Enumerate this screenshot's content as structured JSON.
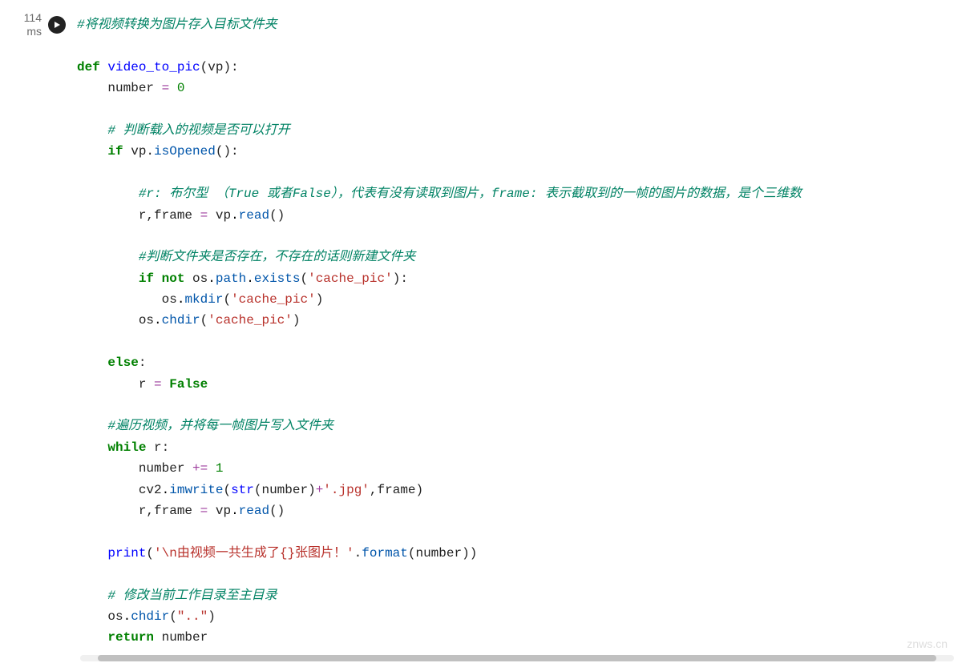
{
  "exec_time_value": "114",
  "exec_time_unit": "ms",
  "toolbar": {
    "add_label": "+",
    "close_label": "✕",
    "check_label": "✓",
    "delete_label": "🗑"
  },
  "watermark": "znws.cn",
  "code": {
    "comment_top": "#将视频转换为图片存入目标文件夹",
    "kw_def": "def",
    "fn_name": "video_to_pic",
    "fn_params": "(vp):",
    "line_number_init_name": "number",
    "line_number_init_op": "=",
    "line_number_init_val": "0",
    "comment_check_open": "# 判断载入的视频是否可以打开",
    "kw_if1": "if",
    "if1_obj": "vp",
    "dot1": ".",
    "if1_method": "isOpened",
    "if1_tail": "():",
    "comment_rframe": "#r: 布尔型 （True 或者False），代表有没有读取到图片，frame: 表示截取到的一帧的图片的数据，是个三维数",
    "rframe_left": "r,frame",
    "rframe_op": "=",
    "rframe_obj": "vp",
    "rframe_method": "read",
    "rframe_tail": "()",
    "comment_mkdir": "#判断文件夹是否存在，不存在的话则新建文件夹",
    "kw_if2": "if",
    "kw_not": "not",
    "exists_obj1": "os",
    "exists_attr1": "path",
    "exists_method": "exists",
    "exists_open": "(",
    "exists_str": "'cache_pic'",
    "exists_close": "):",
    "mkdir_obj": "os",
    "mkdir_method": "mkdir",
    "mkdir_open": "(",
    "mkdir_str": "'cache_pic'",
    "mkdir_close": ")",
    "chdir_obj": "os",
    "chdir_method": "chdir",
    "chdir_open": "(",
    "chdir_str": "'cache_pic'",
    "chdir_close": ")",
    "kw_else": "else",
    "else_colon": ":",
    "else_r": "r",
    "else_op": "=",
    "else_val": "False",
    "comment_loop": "#遍历视频，并将每一帧图片写入文件夹",
    "kw_while": "while",
    "while_cond": "r:",
    "incr_name": "number",
    "incr_op": "+=",
    "incr_val": "1",
    "imw_obj": "cv2",
    "imw_method": "imwrite",
    "imw_open": "(",
    "imw_str_fn": "str",
    "imw_str_arg": "(number)",
    "imw_plus": "+",
    "imw_ext": "'.jpg'",
    "imw_rest": ",frame)",
    "read2_left": "r,frame",
    "read2_op": "=",
    "read2_obj": "vp",
    "read2_method": "read",
    "read2_tail": "()",
    "print_fn": "print",
    "print_open": "(",
    "print_str": "'\\n由视频一共生成了{}张图片！'",
    "print_dot": ".",
    "print_format": "format",
    "print_rest": "(number))",
    "comment_back": "# 修改当前工作目录至主目录",
    "chdir2_obj": "os",
    "chdir2_method": "chdir",
    "chdir2_open": "(",
    "chdir2_str": "\"..\"",
    "chdir2_close": ")",
    "kw_return": "return",
    "return_val": "number"
  }
}
